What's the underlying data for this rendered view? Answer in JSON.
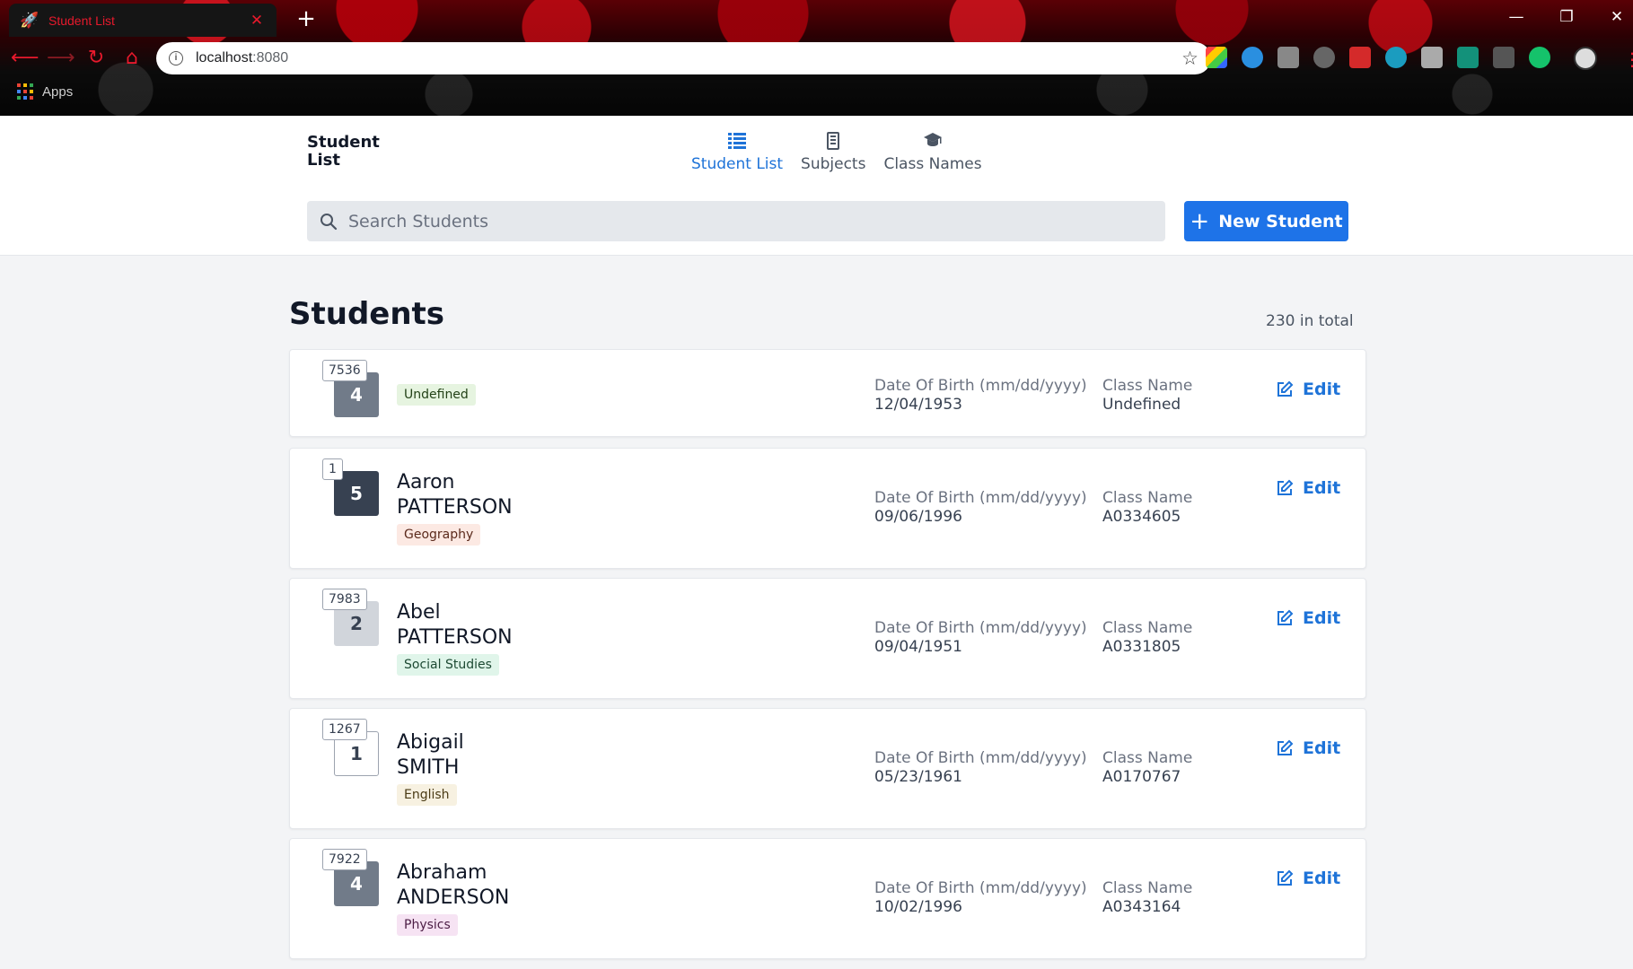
{
  "browser": {
    "tab_title": "Student List",
    "tab_close": "✕",
    "new_tab": "+",
    "url_host": "localhost",
    "url_port": ":8080",
    "bookmarks_apps": "Apps",
    "window_controls": {
      "minimize": "—",
      "restore": "❐",
      "close": "✕"
    }
  },
  "app": {
    "brand_line1": "Student",
    "brand_line2": "List",
    "nav": [
      {
        "label": "Student List",
        "icon": "list-icon",
        "active": true
      },
      {
        "label": "Subjects",
        "icon": "book-icon",
        "active": false
      },
      {
        "label": "Class Names",
        "icon": "graduation-cap-icon",
        "active": false
      }
    ],
    "search_placeholder": "Search Students",
    "new_button": "New Student",
    "accent_color": "#1e73e8"
  },
  "content": {
    "title": "Students",
    "total": "230 in total",
    "dob_label": "Date Of Birth (mm/dd/yyyy)",
    "class_label": "Class Name",
    "edit_label": "Edit",
    "students": [
      {
        "id": "7536",
        "level": "4",
        "first": "",
        "last": "",
        "subject": "Undefined",
        "dob": "12/04/1953",
        "class_name": "Undefined"
      },
      {
        "id": "1",
        "level": "5",
        "first": "Aaron",
        "last": "PATTERSON",
        "subject": "Geography",
        "dob": "09/06/1996",
        "class_name": "A0334605"
      },
      {
        "id": "7983",
        "level": "2",
        "first": "Abel",
        "last": "PATTERSON",
        "subject": "Social Studies",
        "dob": "09/04/1951",
        "class_name": "A0331805"
      },
      {
        "id": "1267",
        "level": "1",
        "first": "Abigail",
        "last": "SMITH",
        "subject": "English",
        "dob": "05/23/1961",
        "class_name": "A0170767"
      },
      {
        "id": "7922",
        "level": "4",
        "first": "Abraham",
        "last": "ANDERSON",
        "subject": "Physics",
        "dob": "10/02/1996",
        "class_name": "A0343164"
      }
    ]
  }
}
